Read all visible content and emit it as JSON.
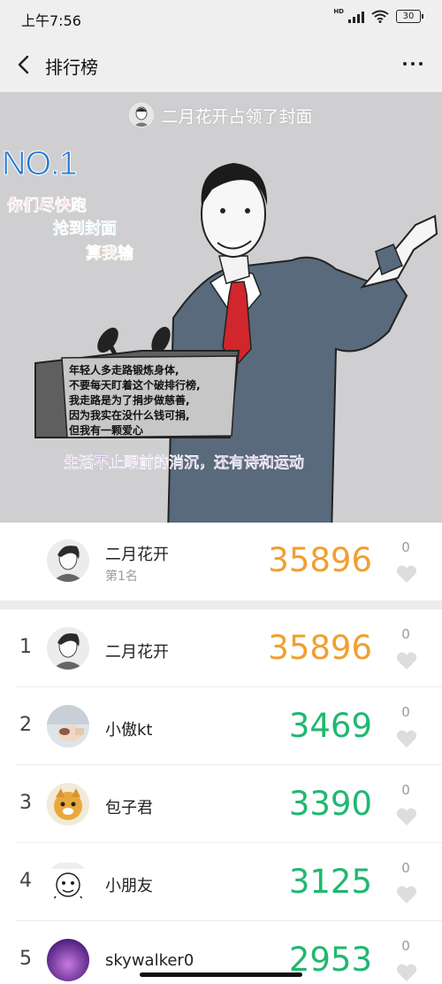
{
  "status_bar": {
    "time": "上午7:56",
    "network": "HD",
    "battery": "30"
  },
  "header": {
    "title": "排行榜"
  },
  "cover": {
    "owner_text": "二月花开占领了封面",
    "headline": "NO.1",
    "taglines": [
      "你们尽快跑",
      "抢到封面",
      "算我输"
    ],
    "speech_lines": [
      "年轻人多走路锻炼身体,",
      "不要每天盯着这个破排行榜,",
      "我走路是为了捐步做慈善,",
      "因为我实在没什么钱可捐,",
      "但我有一颗爱心"
    ],
    "slogan": "生活不止眼前的消沉，还有诗和运动"
  },
  "my_rank": {
    "name": "二月花开",
    "subtitle": "第1名",
    "steps": "35896",
    "likes": "0"
  },
  "ranking": [
    {
      "rank": "1",
      "name": "二月花开",
      "steps": "35896",
      "likes": "0"
    },
    {
      "rank": "2",
      "name": "小傲kt",
      "steps": "3469",
      "likes": "0"
    },
    {
      "rank": "3",
      "name": "包子君",
      "steps": "3390",
      "likes": "0"
    },
    {
      "rank": "4",
      "name": "小朋友",
      "steps": "3125",
      "likes": "0"
    },
    {
      "rank": "5",
      "name": "skywalker0",
      "steps": "2953",
      "likes": "0"
    }
  ],
  "colors": {
    "first_place_steps": "#f0a030",
    "other_steps": "#20b870",
    "like_inactive": "#dddddd"
  },
  "icons": {
    "back": "chevron-left-icon",
    "more": "more-dots-icon",
    "like": "heart-icon"
  }
}
